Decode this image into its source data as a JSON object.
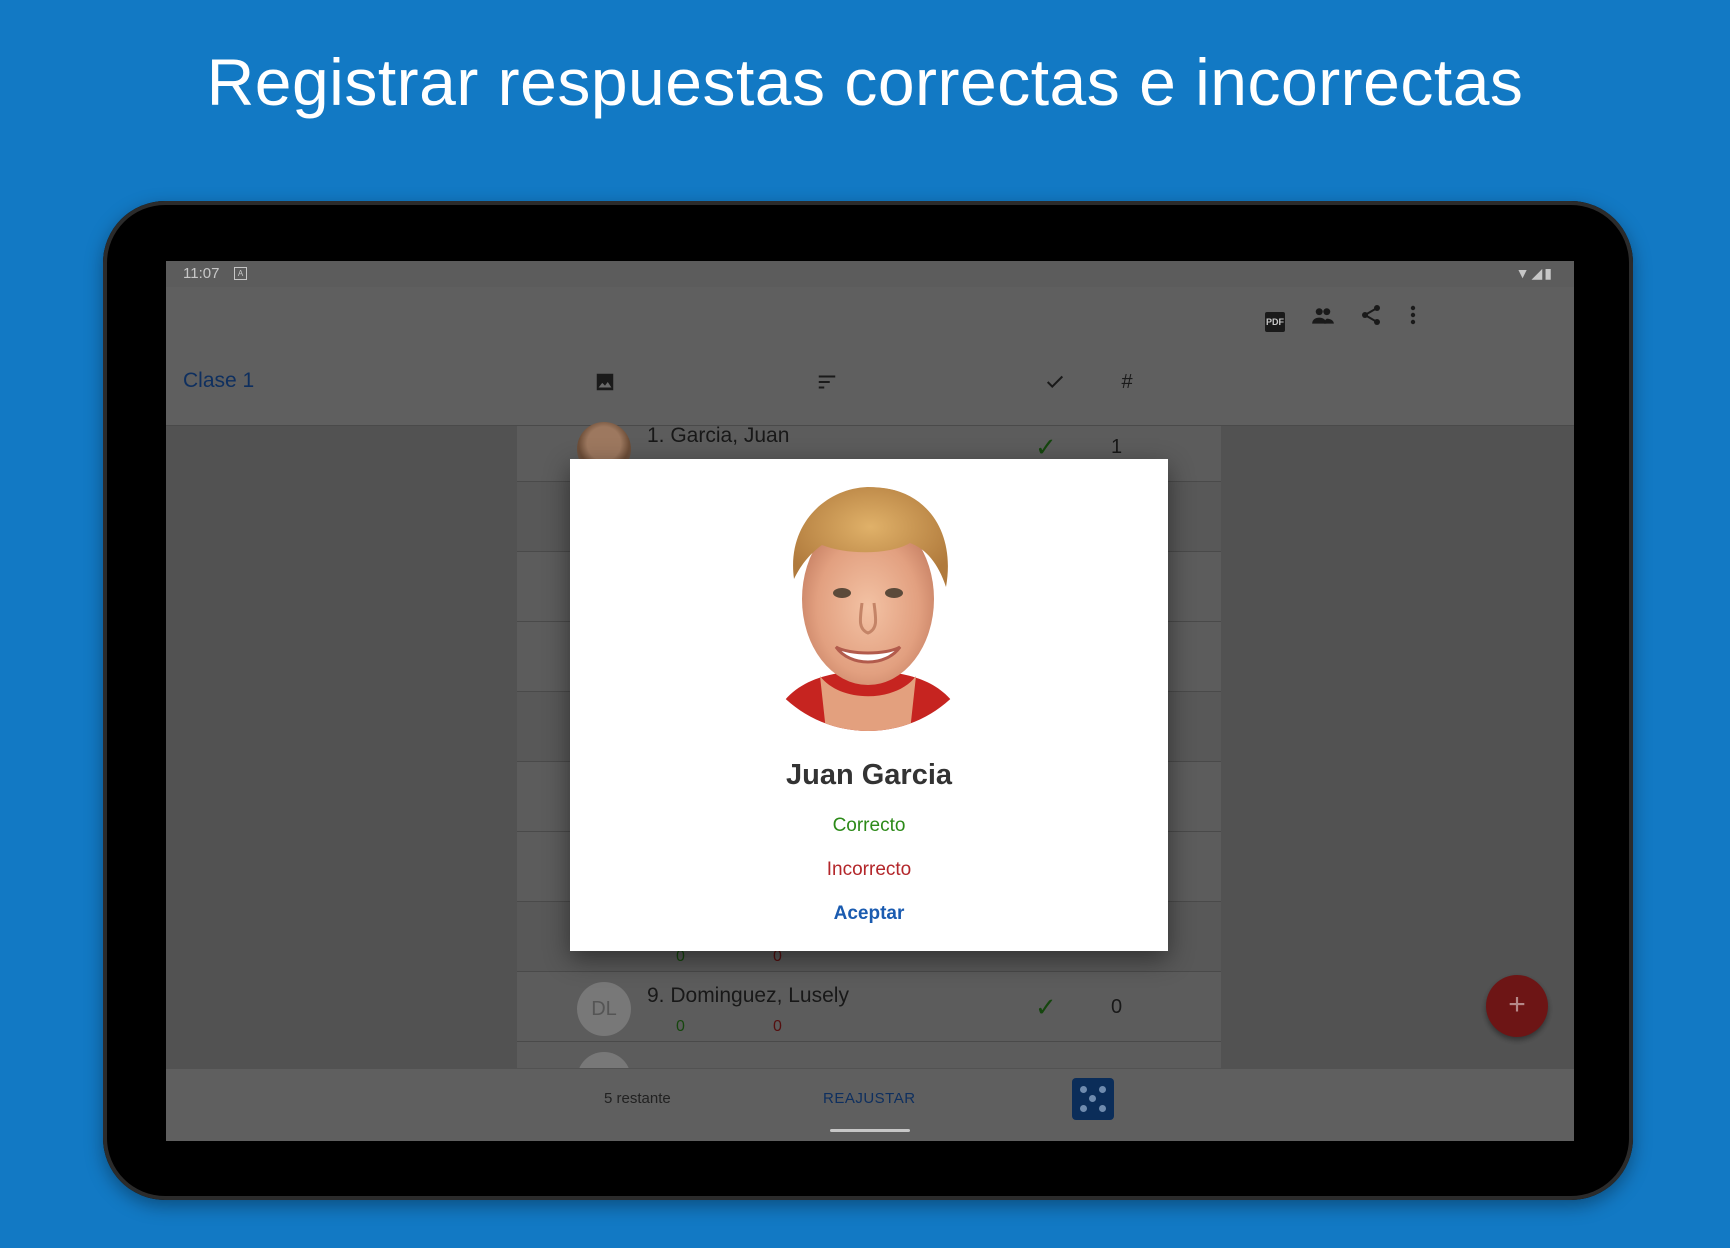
{
  "headline": "Registrar respuestas correctas e incorrectas",
  "status": {
    "time": "11:07",
    "notif_icon": "A"
  },
  "toolbar": {
    "pdf_label": "PDF"
  },
  "header": {
    "class_title": "Clase 1",
    "hash": "#"
  },
  "list": {
    "rows": [
      {
        "name": "1. Garcia, Juan",
        "correct": "",
        "incorrect": "",
        "count": "1"
      },
      {
        "name": "9. Dominguez, Lusely",
        "initials": "DL",
        "correct": "0",
        "incorrect": "0",
        "count": "0"
      }
    ],
    "partial_row": {
      "correct": "0",
      "incorrect": "0"
    }
  },
  "bottombar": {
    "remaining": "5 restante",
    "readjust": "REAJUSTAR"
  },
  "fab": {
    "label": "+"
  },
  "dialog": {
    "student_name": "Juan Garcia",
    "correct": "Correcto",
    "incorrect": "Incorrecto",
    "accept": "Aceptar"
  },
  "colors": {
    "background": "#1279c4",
    "correct": "#2c8a18",
    "incorrect": "#b3262a",
    "accent": "#1a5bb0",
    "fab": "#c62828"
  }
}
